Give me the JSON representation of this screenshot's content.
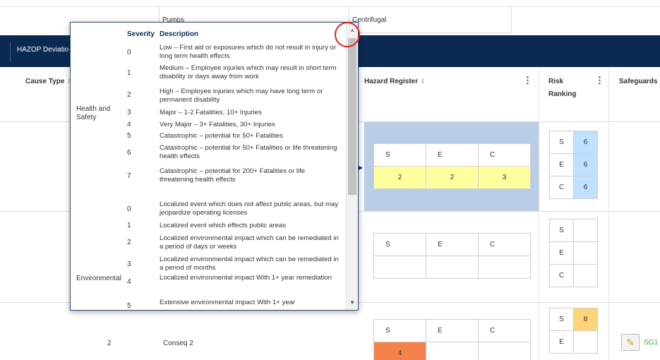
{
  "top_row": {
    "col3": "Pumps",
    "col4": "Centrifugal"
  },
  "nav": {
    "tab_label": "HAZOP Deviatio"
  },
  "columns": {
    "cause_type": "Cause Type",
    "hazard_register": "Hazard Register",
    "risk_ranking_line1": "Risk",
    "risk_ranking_line2": "Ranking",
    "safeguards": "Safeguards",
    "sort_glyph": "⇕",
    "kebab_glyph": "⋮"
  },
  "sec_labels": {
    "s": "S",
    "e": "E",
    "c": "C"
  },
  "rows": [
    {
      "hazard_values": [
        "2",
        "2",
        "3"
      ],
      "risk_values": [
        "6",
        "6",
        "6"
      ]
    },
    {
      "hazard_values": [
        "",
        "",
        ""
      ],
      "risk_values": [
        "",
        "",
        ""
      ]
    },
    {
      "cause_num": "2",
      "conseq": "Conseq 2",
      "hazard_values": [
        "4",
        "",
        ""
      ],
      "risk_values": [
        "8",
        "",
        ""
      ],
      "safeguard": "SG1"
    }
  ],
  "popup": {
    "header_severity": "Severity",
    "header_description": "Description",
    "categories": [
      {
        "name": "Health and Safety",
        "items": [
          {
            "sev": "0",
            "desc": "Low – First aid or exposures which do not result in injury or long term health effects"
          },
          {
            "sev": "1",
            "desc": "Medium – Employee injuries which may result in short term disability or days away from work"
          },
          {
            "sev": "2",
            "desc": "High – Employee injuries which may have long term or permanent disability"
          },
          {
            "sev": "3",
            "desc": "Major – 1-2 Fatalities, 10+ Injuries"
          },
          {
            "sev": "4",
            "desc": "Very Major – 3+ Fatalities, 30+ Injuries"
          },
          {
            "sev": "5",
            "desc": "Catastrophic – potential for 50+ Fatalities"
          },
          {
            "sev": "6",
            "desc": "Catastrophic – potential for 50+ Fatalities or life threatening health effects"
          },
          {
            "sev": "7",
            "desc": "Catastrophic – potential for 200+ Fatalities or life threatening health effects"
          }
        ]
      },
      {
        "name": "Environmental",
        "items": [
          {
            "sev": "0",
            "desc": "Localized event which does not affect public areas, but may jeopardize operating licenses"
          },
          {
            "sev": "1",
            "desc": "Localized event which effects public areas"
          },
          {
            "sev": "2",
            "desc": "Localized environmental impact which can be remediated in a period of days or weeks"
          },
          {
            "sev": "3",
            "desc": "Localized environmental impact which can be remediated in a period of months"
          },
          {
            "sev": "4",
            "desc": "Localized environmental impact With 1+ year remediation"
          },
          {
            "sev": "5",
            "desc": "Extensive environmental impact With 1+ year"
          }
        ]
      }
    ],
    "scroll_up": "▲",
    "scroll_down": "▼"
  },
  "colors": {
    "navy": "#0b2a52",
    "hazard_highlight": "#b9cde6",
    "yellow": "#ffff9e",
    "orange": "#f4824a",
    "blue": "#bfe0ff",
    "amber": "#ffd37a",
    "annotation_red": "#e02020",
    "safeguard_green": "#3fae49"
  },
  "icons": {
    "edit": "pencil-icon"
  }
}
